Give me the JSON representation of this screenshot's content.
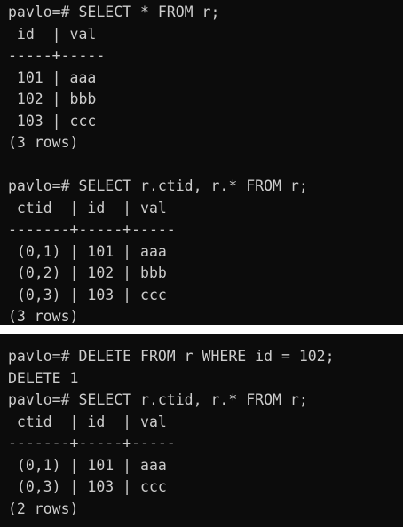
{
  "terminal_1": {
    "lines": [
      "pavlo=# SELECT * FROM r;",
      " id  | val",
      "-----+-----",
      " 101 | aaa",
      " 102 | bbb",
      " 103 | ccc",
      "(3 rows)",
      "",
      "pavlo=# SELECT r.ctid, r.* FROM r;",
      " ctid  | id  | val",
      "-------+-----+-----",
      " (0,1) | 101 | aaa",
      " (0,2) | 102 | bbb",
      " (0,3) | 103 | ccc",
      "(3 rows)"
    ]
  },
  "terminal_2": {
    "lines": [
      "pavlo=# DELETE FROM r WHERE id = 102;",
      "DELETE 1",
      "pavlo=# SELECT r.ctid, r.* FROM r;",
      " ctid  | id  | val",
      "-------+-----+-----",
      " (0,1) | 101 | aaa",
      " (0,3) | 103 | ccc",
      "(2 rows)"
    ]
  },
  "colors": {
    "terminal_background": "#0c0c0c",
    "terminal_text": "#cccccc",
    "page_background": "#ffffff"
  }
}
